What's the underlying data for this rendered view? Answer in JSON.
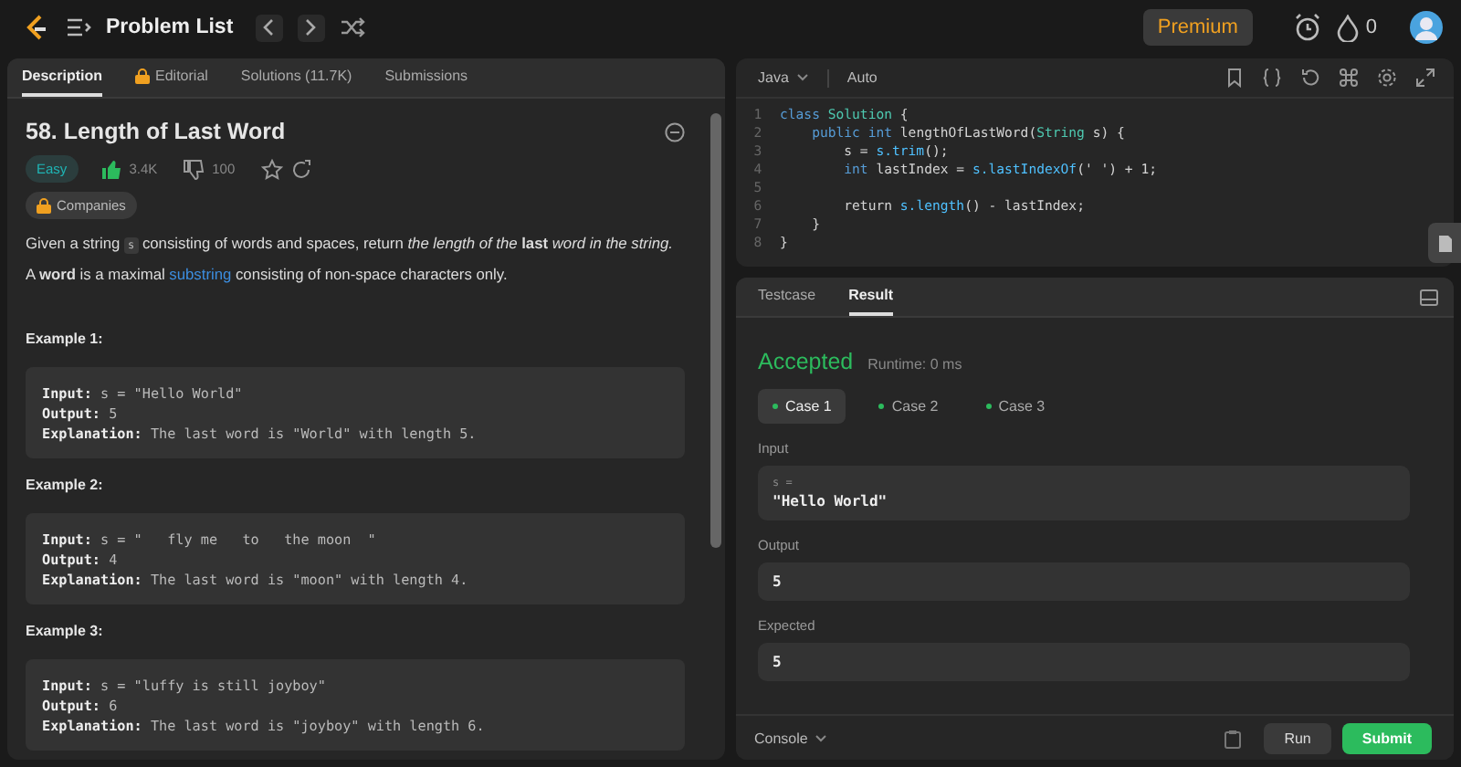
{
  "nav": {
    "title": "Problem List",
    "premium": "Premium",
    "streak": "0"
  },
  "left_tabs": [
    {
      "label": "Description",
      "selected": true,
      "locked": false
    },
    {
      "label": "Editorial",
      "selected": false,
      "locked": true
    },
    {
      "label": "Solutions (11.7K)",
      "selected": false,
      "locked": false
    },
    {
      "label": "Submissions",
      "selected": false,
      "locked": false
    }
  ],
  "problem": {
    "title": "58. Length of Last Word",
    "difficulty": "Easy",
    "likes": "3.4K",
    "dislikes": "100",
    "companies": "Companies",
    "paragraphs": [
      [
        {
          "kind": "text",
          "text": "Given a string "
        },
        {
          "kind": "code",
          "text": "s"
        },
        {
          "kind": "text",
          "text": " consisting of words and spaces, return *the length of the* **last** *word in the string.*"
        }
      ],
      [
        {
          "kind": "text",
          "text": "A **word** is a maximal "
        },
        {
          "kind": "link",
          "text": "substring"
        },
        {
          "kind": "text",
          "text": " consisting of non-space characters only."
        }
      ]
    ],
    "examples": [
      {
        "title": "Example 1:",
        "lines": [
          {
            "label": "Input:",
            "value": "s = \"Hello World\""
          },
          {
            "label": "Output:",
            "value": "5"
          },
          {
            "label": "Explanation:",
            "value": "The last word is \"World\" with length 5."
          }
        ]
      },
      {
        "title": "Example 2:",
        "lines": [
          {
            "label": "Input:",
            "value": "s = \"   fly me   to   the moon  \""
          },
          {
            "label": "Output:",
            "value": "4"
          },
          {
            "label": "Explanation:",
            "value": "The last word is \"moon\" with length 4."
          }
        ]
      },
      {
        "title": "Example 3:",
        "lines": [
          {
            "label": "Input:",
            "value": "s = \"luffy is still joyboy\""
          },
          {
            "label": "Output:",
            "value": "6"
          },
          {
            "label": "Explanation:",
            "value": "The last word is \"joyboy\" with length 6."
          }
        ]
      }
    ]
  },
  "editor": {
    "language": "Java",
    "mode": "Auto",
    "lines": [
      {
        "number": "1",
        "tokens": [
          {
            "kind": "kw",
            "text": "class "
          },
          {
            "kind": "type",
            "text": "Solution"
          },
          {
            "kind": "plain",
            "text": " {"
          }
        ]
      },
      {
        "number": "2",
        "tokens": [
          {
            "kind": "kw",
            "text": "    public int "
          },
          {
            "kind": "plain",
            "text": "lengthOfLastWord("
          },
          {
            "kind": "type",
            "text": "String"
          },
          {
            "kind": "plain",
            "text": " s) {"
          }
        ]
      },
      {
        "number": "3",
        "tokens": [
          {
            "kind": "plain",
            "text": "        s = "
          },
          {
            "kind": "fn",
            "text": "s.trim"
          },
          {
            "kind": "plain",
            "text": "();"
          }
        ]
      },
      {
        "number": "4",
        "tokens": [
          {
            "kind": "kw",
            "text": "        int"
          },
          {
            "kind": "plain",
            "text": " lastIndex = "
          },
          {
            "kind": "fn",
            "text": "s.lastIndexOf"
          },
          {
            "kind": "plain",
            "text": "(' ') + 1;"
          }
        ]
      },
      {
        "number": "5"
      },
      {
        "number": "6",
        "tokens": [
          {
            "kind": "plain",
            "text": "        return "
          },
          {
            "kind": "fn",
            "text": "s.length"
          },
          {
            "kind": "plain",
            "text": "() - lastIndex;"
          }
        ]
      },
      {
        "number": "7",
        "tokens": [
          {
            "kind": "plain",
            "text": "    }"
          }
        ]
      },
      {
        "number": "8",
        "tokens": [
          {
            "kind": "plain",
            "text": "}"
          }
        ]
      }
    ]
  },
  "result_tabs": [
    {
      "label": "Testcase",
      "selected": false
    },
    {
      "label": "Result",
      "selected": true
    }
  ],
  "result": {
    "status": "Accepted",
    "runtime": "Runtime: 0 ms",
    "cases": [
      {
        "label": "Case 1",
        "selected": true
      },
      {
        "label": "Case 2",
        "selected": false
      },
      {
        "label": "Case 3",
        "selected": false
      }
    ],
    "input_label": "Input",
    "input_var": "s =",
    "input_value": "\"Hello World\"",
    "output_label": "Output",
    "output_value": "5",
    "expected_label": "Expected",
    "expected_value": "5"
  },
  "footer": {
    "console": "Console",
    "run": "Run",
    "submit": "Submit"
  }
}
